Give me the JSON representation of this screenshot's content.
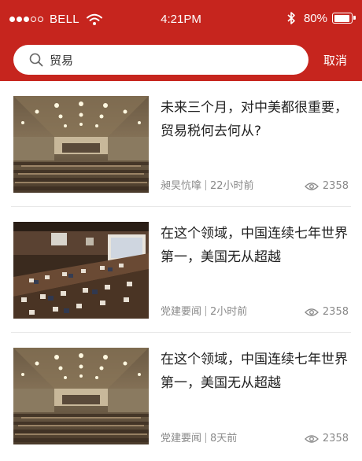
{
  "status_bar": {
    "carrier": "BELL",
    "time": "4:21PM",
    "battery": "80%",
    "battery_level": 0.8
  },
  "search": {
    "value": "贸易",
    "cancel_label": "取消"
  },
  "colors": {
    "brand": "#c6251e",
    "text": "#222222",
    "meta": "#8a8a8a"
  },
  "articles": [
    {
      "title": "未来三个月，对中美都很重要，贸易税何去何从?",
      "source": "昶旲忼嗱",
      "time": "22小时前",
      "views": "2358",
      "image": "conference-hall-photo"
    },
    {
      "title": "在这个领域，中国连续七年世界第一，美国无从超越",
      "source": "党建要闻",
      "time": "2小时前",
      "views": "2358",
      "image": "un-meeting-photo"
    },
    {
      "title": "在这个领域，中国连续七年世界第一，美国无从超越",
      "source": "党建要闻",
      "time": "8天前",
      "views": "2358",
      "image": "conference-hall-photo"
    }
  ]
}
